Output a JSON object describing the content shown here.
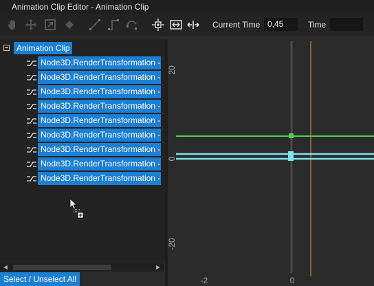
{
  "window": {
    "title": "Animation Clip Editor - Animation Clip"
  },
  "toolbar": {
    "icons": [
      "hand-icon",
      "move-icon",
      "scale-icon",
      "diamond-icon",
      "line-icon",
      "step-icon",
      "spline-icon",
      "frame-all-icon",
      "fit-horizontal-icon",
      "expand-horizontal-icon"
    ],
    "current_time_label": "Current Time",
    "current_time_value": "0,45",
    "time_label": "Time",
    "time_value": ""
  },
  "tree": {
    "root_label": "Animation Clip",
    "items": [
      {
        "label": "Node3D.RenderTransformation -"
      },
      {
        "label": "Node3D.RenderTransformation -"
      },
      {
        "label": "Node3D.RenderTransformation -"
      },
      {
        "label": "Node3D.RenderTransformation -"
      },
      {
        "label": "Node3D.RenderTransformation -"
      },
      {
        "label": "Node3D.RenderTransformation -"
      },
      {
        "label": "Node3D.RenderTransformation -"
      },
      {
        "label": "Node3D.RenderTransformation -"
      },
      {
        "label": "Node3D.RenderTransformation -"
      }
    ]
  },
  "footer": {
    "select_unselect_label": "Select / Unselect All"
  },
  "curve_editor": {
    "y_ticks": [
      "20",
      "0",
      "-20"
    ],
    "x_ticks": [
      "-2",
      "0"
    ],
    "current_time": 0.45,
    "colors": {
      "green_curve": "#4ed04e",
      "cyan_curve": "#7fe3ef",
      "time_cursor": "#e0a030",
      "zero_axis": "#4a4a4a",
      "selection": "#1d7fd3"
    }
  }
}
